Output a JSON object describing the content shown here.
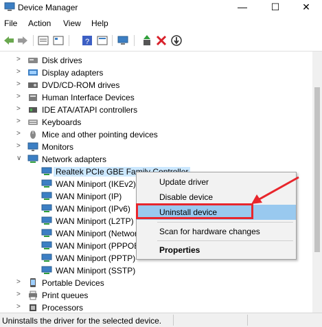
{
  "window": {
    "title": "Device Manager",
    "controls": {
      "minimize": "—",
      "maximize": "☐",
      "close": "✕"
    }
  },
  "menu": [
    "File",
    "Action",
    "View",
    "Help"
  ],
  "toolbar": {
    "icons": [
      "back-icon",
      "forward-icon",
      "properties-icon",
      "refresh-icon",
      "help-icon",
      "view-icon",
      "scan-icon",
      "update-driver-icon",
      "uninstall-icon",
      "disable-icon"
    ]
  },
  "tree": {
    "categories": [
      {
        "label": "Disk drives",
        "icon": "disk-drive-icon"
      },
      {
        "label": "Display adapters",
        "icon": "display-adapter-icon"
      },
      {
        "label": "DVD/CD-ROM drives",
        "icon": "dvd-icon"
      },
      {
        "label": "Human Interface Devices",
        "icon": "hid-icon"
      },
      {
        "label": "IDE ATA/ATAPI controllers",
        "icon": "ide-icon"
      },
      {
        "label": "Keyboards",
        "icon": "keyboard-icon"
      },
      {
        "label": "Mice and other pointing devices",
        "icon": "mouse-icon"
      },
      {
        "label": "Monitors",
        "icon": "monitor-icon"
      },
      {
        "label": "Network adapters",
        "icon": "network-adapter-icon"
      }
    ],
    "network_children": [
      "Realtek PCIe GBE Family Controller",
      "WAN Miniport (IKEv2)",
      "WAN Miniport (IP)",
      "WAN Miniport (IPv6)",
      "WAN Miniport (L2TP)",
      "WAN Miniport (Network Monitor)",
      "WAN Miniport (PPPOE)",
      "WAN Miniport (PPTP)",
      "WAN Miniport (SSTP)"
    ],
    "after": [
      {
        "label": "Portable Devices",
        "icon": "portable-device-icon"
      },
      {
        "label": "Print queues",
        "icon": "printer-icon"
      },
      {
        "label": "Processors",
        "icon": "processor-icon"
      }
    ]
  },
  "context_menu": {
    "update": "Update driver",
    "disable": "Disable device",
    "uninstall": "Uninstall device",
    "scan": "Scan for hardware changes",
    "properties": "Properties"
  },
  "status": "Uninstalls the driver for the selected device.",
  "colors": {
    "highlight": "#99c9ef",
    "selection": "#cce8ff",
    "annotation": "#e8262c"
  }
}
